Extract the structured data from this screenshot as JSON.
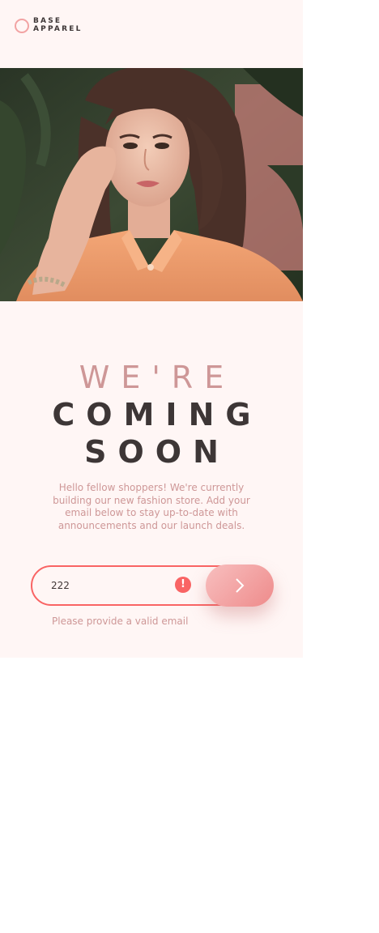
{
  "brand": {
    "line1": "BASE",
    "line2": "APPAREL",
    "accent_color": "#f96464",
    "text_dark": "#3d3636",
    "text_light": "#ce9797"
  },
  "hero": {
    "icon": "woman-portrait-photo"
  },
  "heading": {
    "light": "We're",
    "bold_line1": "Coming",
    "bold_line2": "Soon"
  },
  "description": "Hello fellow shoppers! We're currently building our new fashion store. Add your email below to stay up-to-date with announcements and our launch deals.",
  "form": {
    "email_value": "222",
    "error_icon": "exclamation-icon",
    "submit_icon": "chevron-right-icon",
    "error_message": "Please provide a valid email"
  }
}
